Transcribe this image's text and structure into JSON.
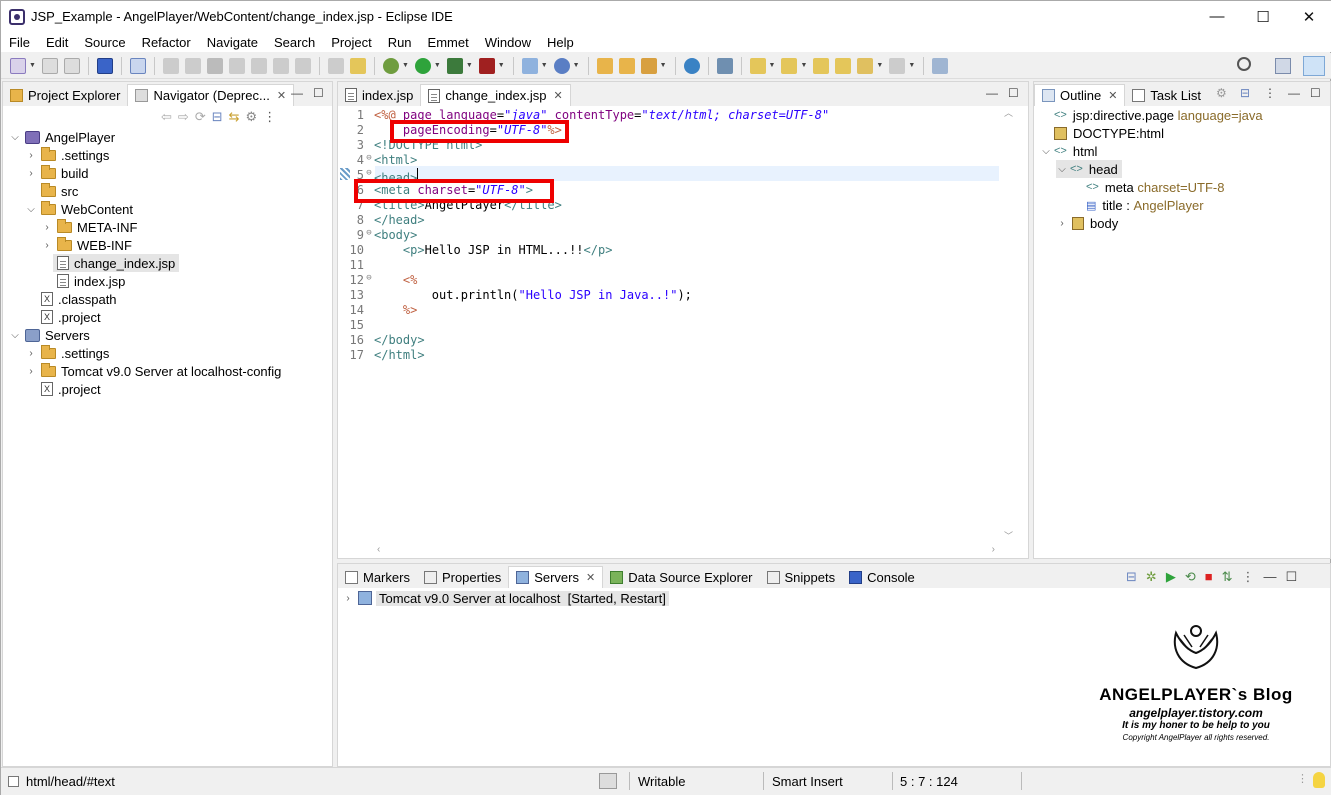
{
  "window": {
    "title": "JSP_Example - AngelPlayer/WebContent/change_index.jsp - Eclipse IDE",
    "controls": [
      "—",
      "☐",
      "✕"
    ]
  },
  "menu": [
    "File",
    "Edit",
    "Source",
    "Refactor",
    "Navigate",
    "Search",
    "Project",
    "Run",
    "Emmet",
    "Window",
    "Help"
  ],
  "left_panel": {
    "tabs": [
      {
        "label": "Project Explorer",
        "active": false
      },
      {
        "label": "Navigator (Deprec...",
        "active": true,
        "close": "✕"
      }
    ],
    "tree": [
      {
        "label": "AngelPlayer",
        "type": "project",
        "expanded": true
      },
      {
        "label": ".settings",
        "type": "folder"
      },
      {
        "label": "build",
        "type": "folder"
      },
      {
        "label": "src",
        "type": "folder"
      },
      {
        "label": "WebContent",
        "type": "folder",
        "expanded": true
      },
      {
        "label": "META-INF",
        "type": "folder"
      },
      {
        "label": "WEB-INF",
        "type": "folder"
      },
      {
        "label": "change_index.jsp",
        "type": "file",
        "selected": true
      },
      {
        "label": "index.jsp",
        "type": "file"
      },
      {
        "label": ".classpath",
        "type": "xml"
      },
      {
        "label": ".project",
        "type": "xml"
      },
      {
        "label": "Servers",
        "type": "project",
        "expanded": true
      },
      {
        "label": ".settings",
        "type": "folder"
      },
      {
        "label": "Tomcat v9.0 Server at localhost-config",
        "type": "folder"
      },
      {
        "label": ".project",
        "type": "xml"
      }
    ]
  },
  "editor": {
    "tabs": [
      {
        "label": "index.jsp",
        "active": false
      },
      {
        "label": "change_index.jsp",
        "active": true,
        "close": "✕"
      }
    ],
    "line_numbers": [
      "1",
      "2",
      "3",
      "4",
      "5",
      "6",
      "7",
      "8",
      "9",
      "10",
      "11",
      "12",
      "13",
      "14",
      "15",
      "16",
      "17"
    ],
    "lines": [
      "<%@ page language=\"java\" contentType=\"text/html; charset=UTF-8\"",
      "    pageEncoding=\"UTF-8\"%>",
      "<!DOCTYPE html>",
      "<html>",
      "<head>",
      "<meta charset=\"UTF-8\">",
      "<title>AngelPlayer</title>",
      "</head>",
      "<body>",
      "    <p>Hello JSP in HTML...!!</p>",
      "",
      "    <%",
      "        out.println(\"Hello JSP in Java..!\");",
      "    %>",
      "",
      "</body>",
      "</html>"
    ]
  },
  "outline_panel": {
    "tabs": [
      {
        "label": "Outline",
        "active": true,
        "close": "✕"
      },
      {
        "label": "Task List",
        "active": false
      }
    ],
    "items": [
      {
        "label": "jsp:directive.page",
        "extra": "language=java"
      },
      {
        "label": "DOCTYPE:html",
        "extra": ""
      },
      {
        "label": "html",
        "extra": ""
      },
      {
        "label": "head",
        "extra": ""
      },
      {
        "label": "meta",
        "extra": "charset=UTF-8"
      },
      {
        "label": "title",
        "extra": "AngelPlayer",
        "sep": " : "
      },
      {
        "label": "body",
        "extra": ""
      }
    ]
  },
  "bottom_panel": {
    "tabs": [
      {
        "label": "Markers",
        "active": false
      },
      {
        "label": "Properties",
        "active": false
      },
      {
        "label": "Servers",
        "active": true,
        "close": "✕"
      },
      {
        "label": "Data Source Explorer",
        "active": false
      },
      {
        "label": "Snippets",
        "active": false
      },
      {
        "label": "Console",
        "active": false
      }
    ],
    "server_row": "Tomcat v9.0 Server at localhost  [Started, Restart]"
  },
  "status": {
    "path": "html/head/#text",
    "mode": "Writable",
    "insert": "Smart Insert",
    "position": "5 : 7 : 124"
  },
  "watermark": {
    "title": "ANGELPLAYER`s Blog",
    "url": "angelplayer.tistory.com",
    "tagline": "It is my honer to be help to you",
    "copyright": "Copyright AngelPlayer all rights reserved."
  },
  "colors": {
    "tag": "#3f7f7f",
    "attr": "#7f007f",
    "value": "#2a00ff",
    "jsp_delim": "#bf5f3f",
    "highlight_box": "#ee0000"
  }
}
